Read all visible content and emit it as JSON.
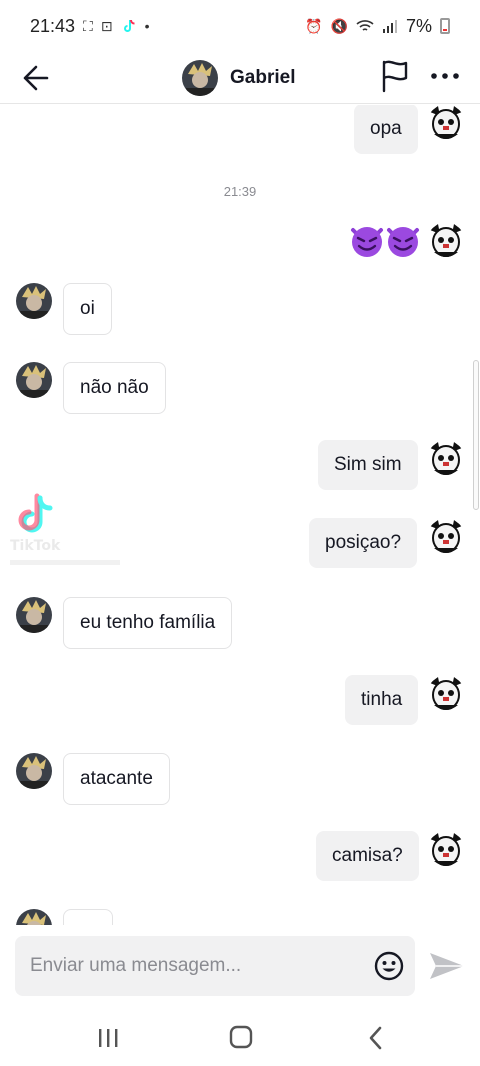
{
  "status_bar": {
    "time": "21:43",
    "battery": "7%"
  },
  "header": {
    "contact_name": "Gabriel"
  },
  "messages": {
    "timestamp": "21:39",
    "m1": "opa",
    "m2_emoji": "smiling-imp-emoji x2",
    "m3": "oi",
    "m4": "não não",
    "m5": "Sim sim",
    "m6": "posiçao?",
    "m7": "eu tenho família",
    "m8": "tinha",
    "m9": "atacante",
    "m10": "camisa?"
  },
  "watermark": {
    "brand": "TikTok"
  },
  "composer": {
    "placeholder": "Enviar uma mensagem..."
  },
  "colors": {
    "outgoing_bubble": "#f1f1f2",
    "incoming_border": "#e3e3e4",
    "text": "#161823",
    "timestamp": "#8a8b91"
  }
}
